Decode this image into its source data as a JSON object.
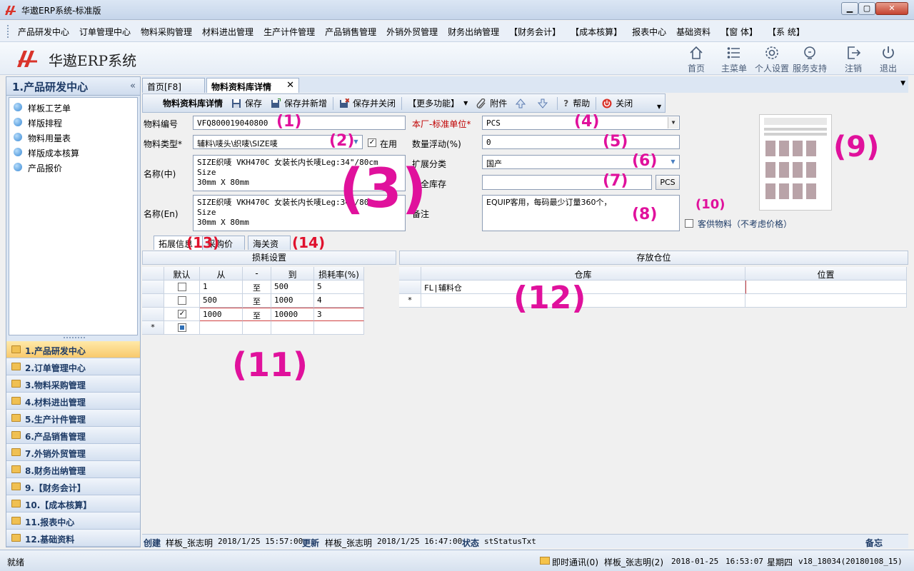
{
  "window": {
    "title": "华遨ERP系统-标准版"
  },
  "menu": [
    "产品研发中心",
    "订单管理中心",
    "物料采购管理",
    "材料进出管理",
    "生产计件管理",
    "产品销售管理",
    "外销外贸管理",
    "财务出纳管理",
    "【财务会计】",
    "【成本核算】",
    "报表中心",
    "基础资料",
    "【窗 体】",
    "【系 统】"
  ],
  "header": {
    "app_name": "华遨ERP系统",
    "buttons": [
      {
        "label": "首页",
        "icon": "home-icon"
      },
      {
        "label": "主菜单",
        "icon": "list-icon"
      },
      {
        "label": "个人设置",
        "icon": "gear-icon"
      },
      {
        "label": "服务支持",
        "icon": "support-icon"
      },
      {
        "label": "注销",
        "icon": "logout-icon"
      },
      {
        "label": "退出",
        "icon": "power-icon"
      }
    ]
  },
  "left": {
    "title": "1.产品研发中心",
    "collapse": "«",
    "items": [
      "样板工艺单",
      "样版排程",
      "物料用量表",
      "样版成本核算",
      "产品报价"
    ],
    "modules": [
      "1.产品研发中心",
      "2.订单管理中心",
      "3.物料采购管理",
      "4.材料进出管理",
      "5.生产计件管理",
      "6.产品销售管理",
      "7.外销外贸管理",
      "8.财务出纳管理",
      "9.【财务会计】",
      "10.【成本核算】",
      "11.报表中心",
      "12.基础资料"
    ]
  },
  "tabs": {
    "home": "首页[F8]",
    "detail": "物料资料库详情",
    "close": "✕"
  },
  "toolbar": {
    "title": "物料资料库详情",
    "save": "保存",
    "save_new": "保存并新增",
    "save_close": "保存并关闭",
    "more": "【更多功能】",
    "attach": "附件",
    "help": "帮助",
    "close": "关闭"
  },
  "form": {
    "code_label": "物料编号",
    "code": "VFQ800019040800",
    "type_label": "物料类型*",
    "type": "辅料\\唛头\\织唛\\SIZE唛",
    "in_use_label": "在用",
    "name_cn_label": "名称(中)",
    "name_cn": "SIZE织唛 VKH470C 女装长内长唛Leg:34\"/80cm Size\n30mm X 80mm",
    "name_en_label": "名称(En)",
    "name_en": "SIZE织唛 VKH470C 女装长内长唛Leg:34\"/80cm Size\n30mm X 80mm",
    "unit_label": "本厂-标准单位*",
    "unit": "PCS",
    "qty_float_label": "数量浮动(%)",
    "qty_float": "0",
    "ext_class_label": "扩展分类",
    "ext_class": "国产",
    "safety_label": "安全库存",
    "safety": "",
    "safety_unit": "PCS",
    "remark_label": "备注",
    "remark": "EQUIP客用，每码最少订量360个，",
    "consign_label": "客供物料（不考虑价格）"
  },
  "inner_tabs": [
    "拓展信息",
    "采购价格",
    "海关资料"
  ],
  "loss": {
    "title": "损耗设置",
    "columns": [
      "默认",
      "从",
      "-",
      "到",
      "损耗率(%)"
    ],
    "rows": [
      {
        "default": false,
        "from": "1",
        "to_sym": "至",
        "to": "500",
        "rate": "5"
      },
      {
        "default": false,
        "from": "500",
        "to_sym": "至",
        "to": "1000",
        "rate": "4"
      },
      {
        "default": true,
        "from": "1000",
        "to_sym": "至",
        "to": "10000",
        "rate": "3"
      }
    ],
    "new_row_marker": "*"
  },
  "storage": {
    "title": "存放仓位",
    "columns": [
      "仓库",
      "位置"
    ],
    "rows": [
      {
        "warehouse": "FL|辅料仓",
        "location": ""
      }
    ],
    "new_row_marker": "*"
  },
  "callouts": [
    "(1)",
    "(2)",
    "(3)",
    "(4)",
    "(5)",
    "(6)",
    "(7)",
    "(8)",
    "(9)",
    "(10)",
    "(11)",
    "(12)",
    "(13)",
    "(14)"
  ],
  "audit": {
    "created_label": "创建",
    "created_by": "样板_张志明",
    "created_at": "2018/1/25 15:57:00",
    "updated_label": "更新",
    "updated_by": "样板_张志明",
    "updated_at": "2018/1/25 16:47:00",
    "status_label": "状态",
    "status": "stStatusTxt",
    "memo": "备忘"
  },
  "status": {
    "ready": "就绪",
    "im": "即时通讯(0)",
    "user": "样板_张志明(2)",
    "date": "2018-01-25",
    "time": "16:53:07",
    "weekday": "星期四",
    "version": "v18_18034(20180108_15)"
  },
  "colors": {
    "callout": "#e0119c",
    "required": "#c00000",
    "accent": "#1e3b66"
  }
}
